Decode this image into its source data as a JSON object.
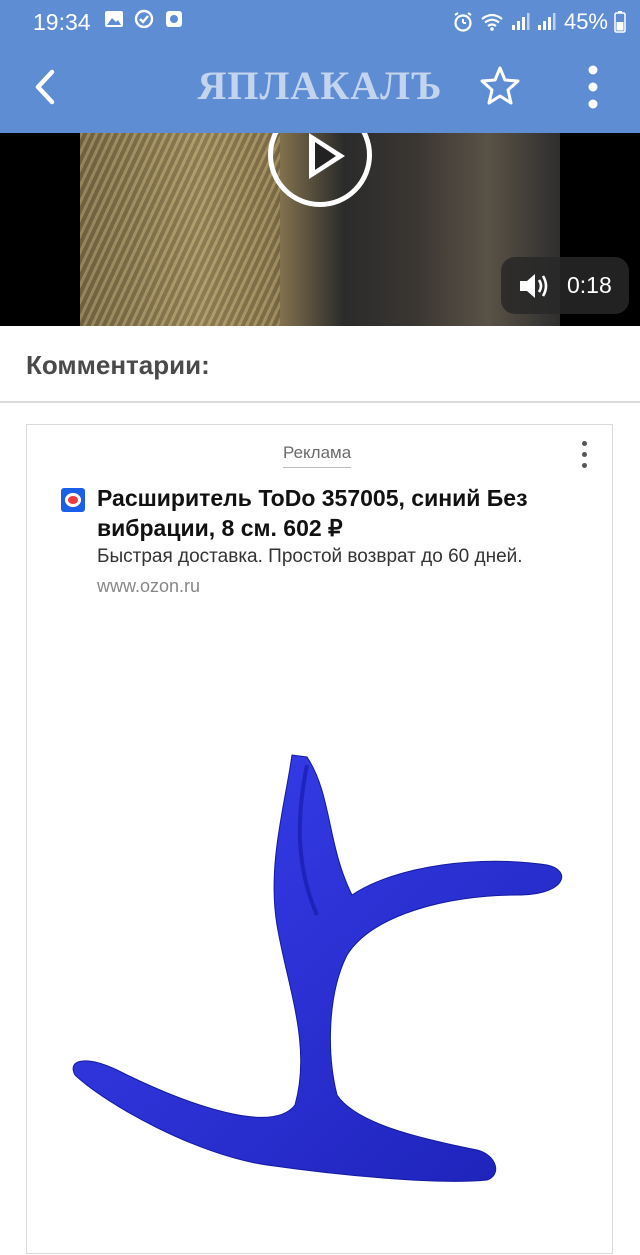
{
  "status_bar": {
    "time": "19:34",
    "battery_pct": "45%",
    "icons_left": [
      "gallery-icon",
      "sync-icon",
      "app-icon"
    ],
    "icons_right": [
      "alarm-icon",
      "wifi-icon",
      "signal-icon",
      "signal-icon",
      "battery-icon"
    ]
  },
  "toolbar": {
    "logo_text": "ЯПЛАКАЛЪ",
    "color": "#5f8dd3"
  },
  "video": {
    "duration": "0:18"
  },
  "comments": {
    "title": "Комментарии:"
  },
  "ad": {
    "label": "Реклама",
    "title": "Расширитель ToDo 357005, синий Без вибрации, 8 см. 602 ₽",
    "description": "Быстрая доставка. Простой возврат до 60 дней.",
    "domain": "www.ozon.ru",
    "product_color": "#2a2fd6"
  }
}
